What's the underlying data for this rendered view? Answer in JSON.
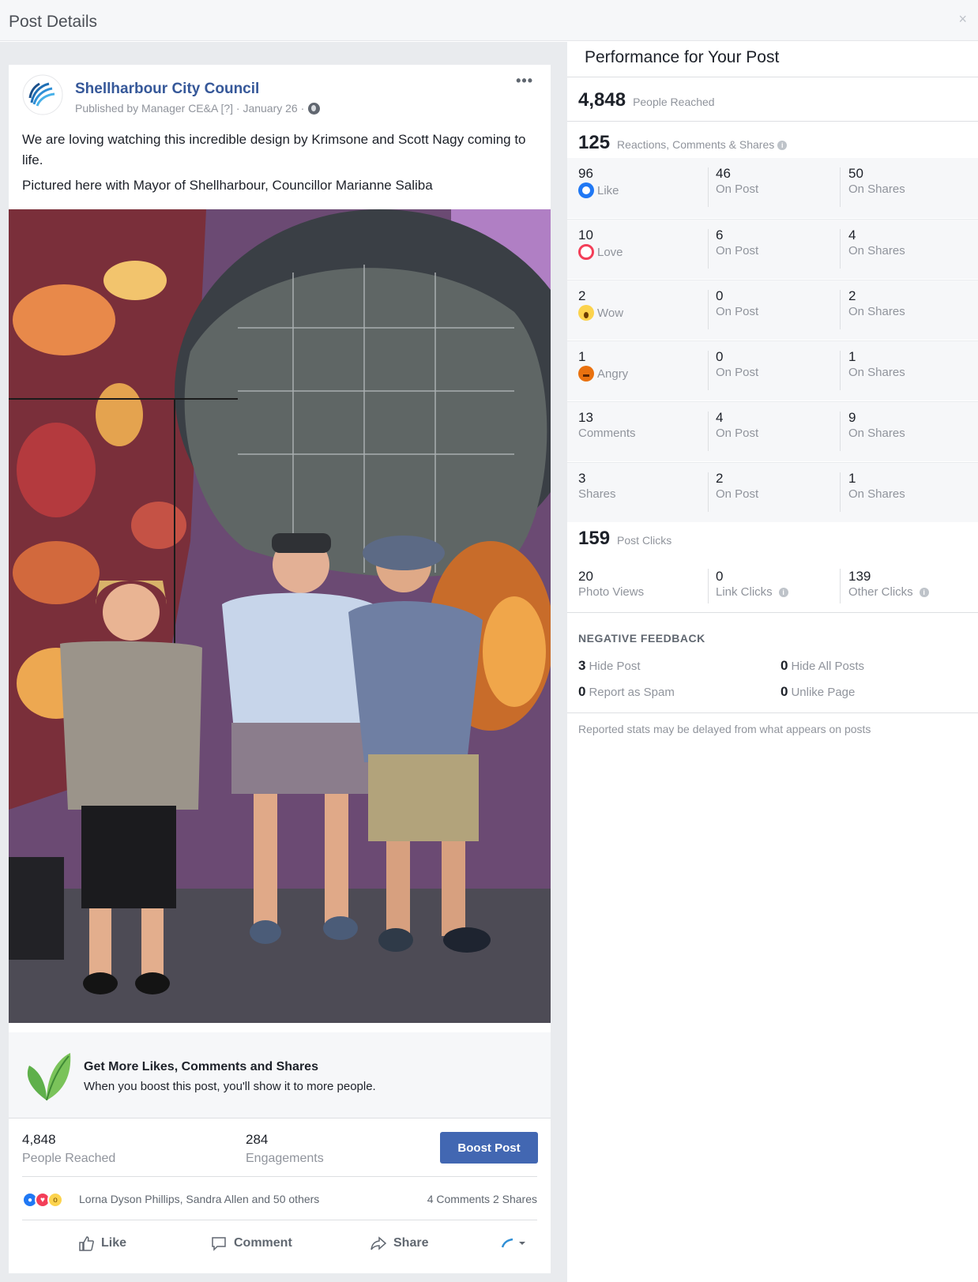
{
  "modal": {
    "title": "Post Details",
    "close_icon": "×"
  },
  "post": {
    "page_name": "Shellharbour City Council",
    "meta": "Published by Manager CE&A [?] · January 26 ·",
    "text_line1": "We are loving watching this incredible design by Krimsone and Scott Nagy coming to life.",
    "text_line2": "Pictured here with Mayor of Shellharbour, Councillor Marianne Saliba",
    "more_label": "•••"
  },
  "promo": {
    "title": "Get More Likes, Comments and Shares",
    "description": "When you boost this post, you'll show it to more people."
  },
  "post_stats": {
    "reached_value": "4,848",
    "reached_label": "People Reached",
    "engagements_value": "284",
    "engagements_label": "Engagements",
    "boost_label": "Boost Post"
  },
  "reactions_bar": {
    "names": "Lorna Dyson Phillips, Sandra Allen and 50 others",
    "counts": "4 Comments  2 Shares"
  },
  "actions": {
    "like": "Like",
    "comment": "Comment",
    "share": "Share"
  },
  "performance": {
    "title": "Performance for Your Post",
    "reached_value": "4,848",
    "reached_label": "People Reached",
    "engagement_value": "125",
    "engagement_label": "Reactions, Comments & Shares",
    "rows": [
      {
        "value": "96",
        "label": "Like",
        "icon": "like-reaction-icon",
        "post_value": "46",
        "post_label": "On Post",
        "shares_value": "50",
        "shares_label": "On Shares"
      },
      {
        "value": "10",
        "label": "Love",
        "icon": "love-reaction-icon",
        "post_value": "6",
        "post_label": "On Post",
        "shares_value": "4",
        "shares_label": "On Shares"
      },
      {
        "value": "2",
        "label": "Wow",
        "icon": "wow-reaction-icon",
        "post_value": "0",
        "post_label": "On Post",
        "shares_value": "2",
        "shares_label": "On Shares"
      },
      {
        "value": "1",
        "label": "Angry",
        "icon": "angry-reaction-icon",
        "post_value": "0",
        "post_label": "On Post",
        "shares_value": "1",
        "shares_label": "On Shares"
      },
      {
        "value": "13",
        "label": "Comments",
        "post_value": "4",
        "post_label": "On Post",
        "shares_value": "9",
        "shares_label": "On Shares"
      },
      {
        "value": "3",
        "label": "Shares",
        "post_value": "2",
        "post_label": "On Post",
        "shares_value": "1",
        "shares_label": "On Shares"
      }
    ],
    "clicks_value": "159",
    "clicks_label": "Post Clicks",
    "photo_views_value": "20",
    "photo_views_label": "Photo Views",
    "link_clicks_value": "0",
    "link_clicks_label": "Link Clicks",
    "other_clicks_value": "139",
    "other_clicks_label": "Other Clicks",
    "negative_title": "NEGATIVE FEEDBACK",
    "hide_post_value": "3",
    "hide_post_label": "Hide Post",
    "hide_all_value": "0",
    "hide_all_label": "Hide All Posts",
    "spam_value": "0",
    "spam_label": "Report as Spam",
    "unlike_value": "0",
    "unlike_label": "Unlike Page",
    "footnote": "Reported stats may be delayed from what appears on posts"
  },
  "colors": {
    "link_blue": "#365899",
    "button_blue": "#4267b2",
    "like_blue": "#2078f4",
    "love_red": "#f33e58",
    "muted_gray": "#90949c"
  }
}
